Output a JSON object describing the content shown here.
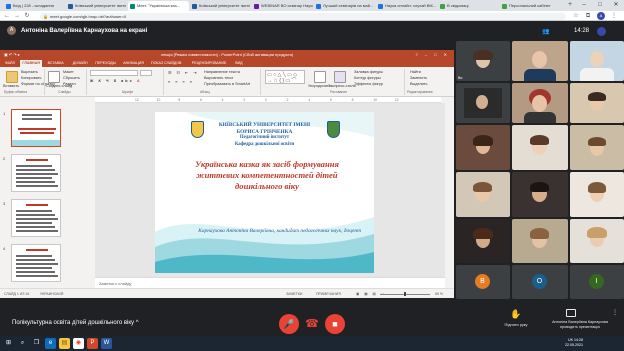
{
  "browser": {
    "tabs": [
      {
        "label": "Вхід | 228 - складання",
        "active": false,
        "color": "#1a73e8"
      },
      {
        "label": "Київський університет імені",
        "active": false,
        "color": "#1f5c99"
      },
      {
        "label": "Meet: \"Українська каз...",
        "active": true,
        "color": "#00897b"
      },
      {
        "label": "Київський університет імені",
        "active": false,
        "color": "#1f5c99"
      },
      {
        "label": "WEBINAR ВО семінар Науко...",
        "active": false,
        "color": "#6a1b9a"
      },
      {
        "label": "Лучший семінарів на май...",
        "active": false,
        "color": "#1a73e8"
      },
      {
        "label": "Наука онлайн: слухай ВІК...",
        "active": false,
        "color": "#1a73e8"
      },
      {
        "label": "В свідомаці",
        "active": false,
        "color": "#43a047"
      },
      {
        "label": "Персональний кабінет",
        "active": false,
        "color": "#43a047"
      }
    ],
    "url": "meet.google.com/qjb-hnqc-nbi?authuser=0"
  },
  "meet": {
    "presenter_title": "Антоніна Валеріївна Карнаухова на екрані",
    "clock": "14:28",
    "self_label": "Ви",
    "meeting_name": "Полікультурна освіта дітей дошкільного віку",
    "meeting_chevron": "^",
    "raise_hand": "Підняти руку",
    "presenting_label": "Антоніна Валеріївна Карнаухова\nпроводить презентацію",
    "letters": {
      "b": "В",
      "o": "О",
      "i": "І"
    },
    "colors": {
      "b": "#e67c22",
      "o": "#1a5f8a",
      "i": "#33691e",
      "accent": "#ea4335"
    }
  },
  "ppt": {
    "title": "лекція [Режим совместимости] - PowerPoint (Сбой активации продукта)",
    "tabs": [
      "ФАЙЛ",
      "ГЛАВНАЯ",
      "ВСТАВКА",
      "ДИЗАЙН",
      "ПЕРЕХОДЫ",
      "АНИМАЦИЯ",
      "ПОКАЗ СЛАЙДОВ",
      "РЕЦЕНЗИРОВАНИЕ",
      "ВИД"
    ],
    "ribbon": {
      "paste": "Вставить",
      "cut": "Вырезать",
      "copy": "Копировать",
      "format": "Формат по образцу",
      "create_slide": "Создать слайд",
      "layout": "Макет",
      "reset": "Сбросить",
      "section": "Раздел",
      "clipboard": "Буфер обмена",
      "slides": "Слайды",
      "font": "Шрифт",
      "paragraph": "Абзац",
      "text_dir": "Направление текста",
      "align_text": "Выровнять текст",
      "smartart": "Преобразовать в SmartArt",
      "arrange": "Упорядочить",
      "quick_styles": "Экспресс-стили",
      "fill": "Заливка фигуры",
      "outline": "Контур фигуры",
      "effects": "Эффекты фигур",
      "drawing": "Рисование",
      "find": "Найти",
      "replace": "Заменить",
      "select": "Выделить",
      "editing": "Редактирование"
    },
    "ruler": [
      "12",
      "10",
      "8",
      "6",
      "4",
      "2",
      "0",
      "2",
      "4",
      "6",
      "8",
      "10",
      "12"
    ],
    "thumbs": [
      "1",
      "2",
      "3",
      "4",
      "5"
    ],
    "slide": {
      "uni_line1": "КИЇВСЬКИЙ УНІВЕРСИТЕТ ІМЕНІ",
      "uni_line2": "БОРИСА ГРІНЧЕНКА",
      "uni_line3": "Педагогічний інститут",
      "uni_line4": "Кафедра дошкільної освіти",
      "title": "Українська казка як засіб формування життєвих компетентностей дітей дошкільного віку",
      "author": "Карнаухова Антоніна Валеріївна, кандидат педагогічних наук, доцент"
    },
    "notes": "Заметки к слайду",
    "status": {
      "slide": "СЛАЙД 1 ИЗ 16",
      "lang": "УКРАИНСКИЙ",
      "notes_btn": "ЗАМЕТКИ",
      "comments_btn": "ПРИМЕЧАНИЯ",
      "zoom": "65 %"
    }
  },
  "taskbar": {
    "lang": "UK",
    "time": "14:28",
    "date": "22.05.2021"
  }
}
